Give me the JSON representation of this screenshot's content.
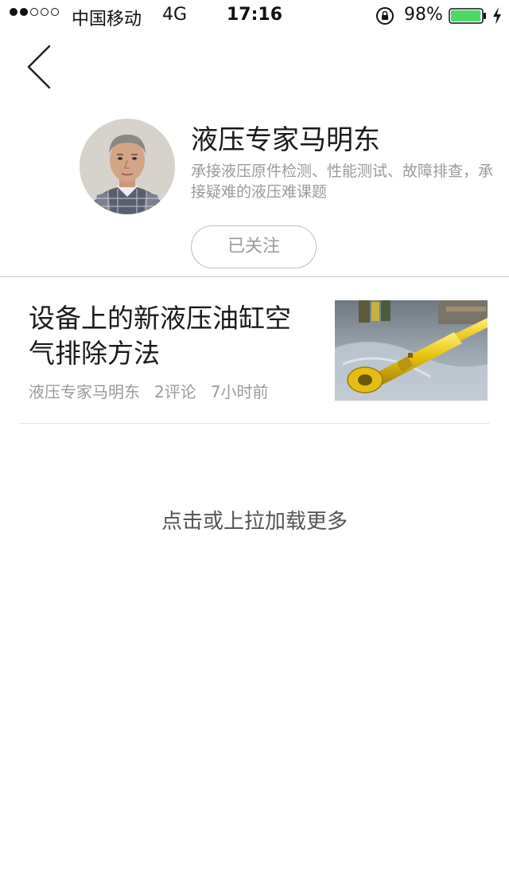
{
  "status_bar": {
    "carrier": "中国移动",
    "network": "4G",
    "time": "17:16",
    "battery_percent": "98%",
    "battery_level": 0.98,
    "battery_color": "#4cd964",
    "signal_filled": 2,
    "signal_total": 5
  },
  "nav": {
    "back_icon": "chevron-left-icon"
  },
  "profile": {
    "name": "液压专家马明东",
    "description": "承接液压原件检测、性能测试、故障排查，承接疑难的液压难课题",
    "follow_label": "已关注"
  },
  "articles": [
    {
      "title": "设备上的新液压油缸空气排除方法",
      "author": "液压专家马明东",
      "comments": "2评论",
      "time": "7小时前"
    }
  ],
  "load_more_label": "点击或上拉加载更多"
}
